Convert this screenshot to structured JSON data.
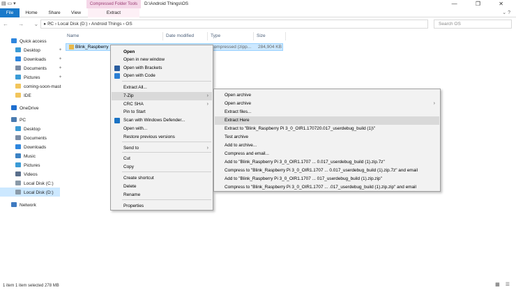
{
  "window": {
    "title": "D:\\Android Things\\OS",
    "contextual_tab_title": "Compressed Folder Tools",
    "controls": "— ❐ ✕"
  },
  "ribbon": {
    "tabs": [
      "File",
      "Home",
      "Share",
      "View",
      "Extract"
    ],
    "right_controls": "⌄ ?"
  },
  "address_bar": {
    "nav_buttons": "← → ⌄ ↑",
    "path": "▸ PC › Local Disk (D:) › Android Things › OS",
    "search_placeholder": "Search OS"
  },
  "nav_pane": {
    "items": [
      {
        "label": "Quick access",
        "icon": "star-icon",
        "pinned": false
      },
      {
        "label": "Desktop",
        "icon": "desktop-icon",
        "pinned": true
      },
      {
        "label": "Downloads",
        "icon": "download-icon",
        "pinned": true
      },
      {
        "label": "Documents",
        "icon": "documents-icon",
        "pinned": true
      },
      {
        "label": "Pictures",
        "icon": "pictures-icon",
        "pinned": true
      },
      {
        "label": "coming-soon-mast",
        "icon": "folder-icon",
        "pinned": false
      },
      {
        "label": "IDE",
        "icon": "folder-icon",
        "pinned": false
      },
      {
        "label": "OneDrive",
        "icon": "cloud-icon",
        "pinned": false
      },
      {
        "label": "PC",
        "icon": "pc-icon",
        "pinned": false
      },
      {
        "label": "Desktop",
        "icon": "desktop-icon",
        "pinned": false
      },
      {
        "label": "Documents",
        "icon": "documents-icon",
        "pinned": false
      },
      {
        "label": "Downloads",
        "icon": "download-icon",
        "pinned": false
      },
      {
        "label": "Music",
        "icon": "music-icon",
        "pinned": false
      },
      {
        "label": "Pictures",
        "icon": "pictures-icon",
        "pinned": false
      },
      {
        "label": "Videos",
        "icon": "videos-icon",
        "pinned": false
      },
      {
        "label": "Local Disk (C:)",
        "icon": "drive-icon",
        "pinned": false
      },
      {
        "label": "Local Disk (D:)",
        "icon": "drive-icon",
        "pinned": false
      },
      {
        "label": "Network",
        "icon": "network-icon",
        "pinned": false
      }
    ],
    "pin_glyph": "✦"
  },
  "file_list": {
    "columns": [
      "Name",
      "Date modified",
      "Type",
      "Size"
    ],
    "rows": [
      {
        "name": "Blink_Raspberry P",
        "type": "Compressed (zipp...",
        "size": "284,904 KB"
      }
    ]
  },
  "context_menu": {
    "items": [
      "Open",
      "Open in new window",
      "Open with Brackets",
      "Open with Code",
      "Extract All...",
      "7-Zip",
      "CRC SHA",
      "Pin to Start",
      "Scan with Windows Defender...",
      "Open with...",
      "Restore previous versions",
      "Send to",
      "Cut",
      "Copy",
      "Create shortcut",
      "Delete",
      "Rename",
      "Properties"
    ],
    "submenu_arrow": "›"
  },
  "submenu_7zip": {
    "items": [
      "Open archive",
      "Open archive",
      "Extract files...",
      "Extract Here",
      "Extract to \"Blink_Raspberry Pi 3_0_OIR1.170720.017_userdebug_build (1)\\\"",
      "Test archive",
      "Add to archive...",
      "Compress and email...",
      "Add to \"Blink_Raspberry Pi 3_0_OIR1.1707 ... 0.017_userdebug_build (1).zip.7z\"",
      "Compress to \"Blink_Raspberry Pi 3_0_OIR1.1707 ... 0.017_userdebug_build (1).zip.7z\" and email",
      "Add to \"Blink_Raspberry Pi 3_0_OIR1.1707 ... 017_userdebug_build (1).zip.zip\"",
      "Compress to \"Blink_Raspberry Pi 3_0_OIR1.1707 ... .017_userdebug_build (1).zip.zip\" and email"
    ]
  },
  "status_bar": {
    "text": "1 item    1 item selected  278 MB",
    "view_icons": "▦ ☰"
  }
}
